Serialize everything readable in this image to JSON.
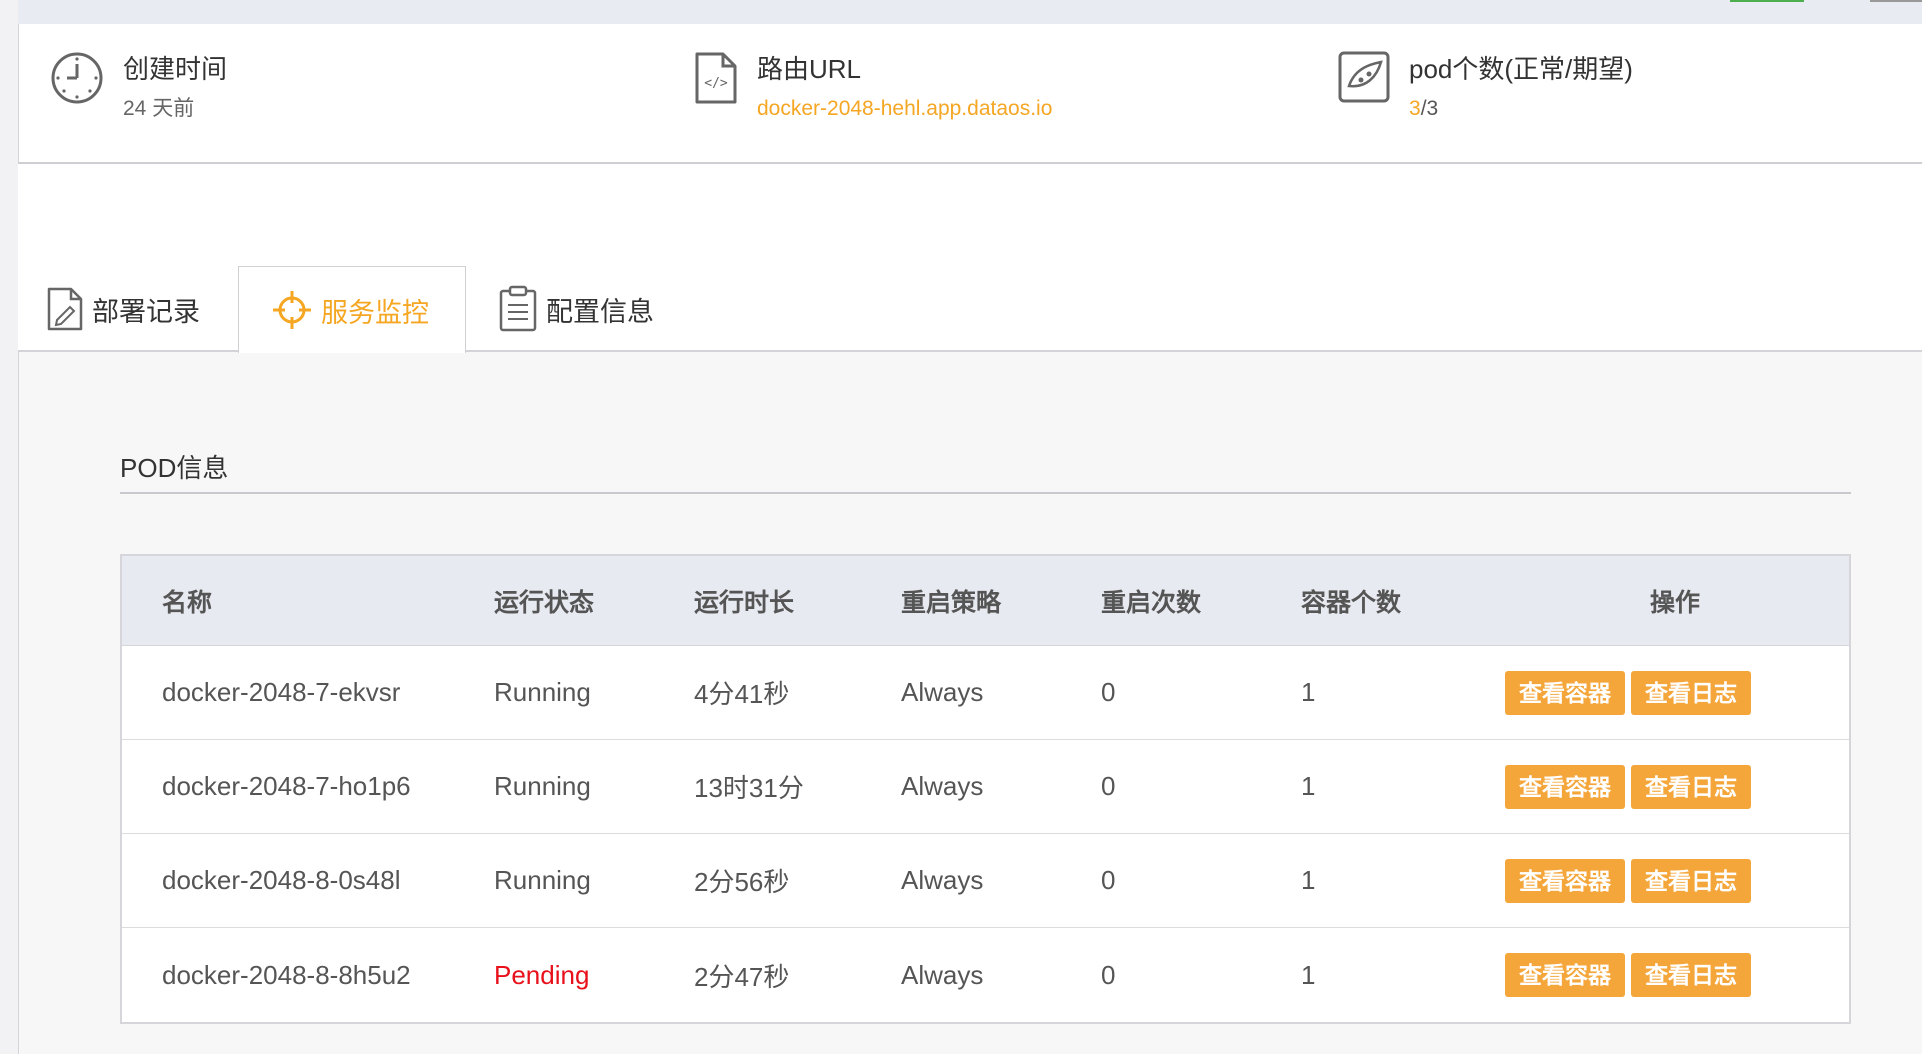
{
  "summary": {
    "created": {
      "icon": "clock-icon",
      "label": "创建时间",
      "value": "24 天前"
    },
    "route": {
      "icon": "code-file-icon",
      "label": "路由URL",
      "value": "docker-2048-hehl.app.dataos.io"
    },
    "pods": {
      "icon": "pod-icon",
      "label": "pod个数(正常/期望)",
      "ok": "3",
      "total": "/3"
    }
  },
  "tabs": [
    {
      "icon": "document-edit-icon",
      "label": "部署记录",
      "active": false
    },
    {
      "icon": "target-icon",
      "label": "服务监控",
      "active": true
    },
    {
      "icon": "clipboard-icon",
      "label": "配置信息",
      "active": false
    }
  ],
  "section": {
    "title": "POD信息"
  },
  "table": {
    "headers": [
      "名称",
      "运行状态",
      "运行时长",
      "重启策略",
      "重启次数",
      "容器个数",
      "操作"
    ],
    "rows": [
      {
        "name": "docker-2048-7-ekvsr",
        "status": "Running",
        "uptime": "4分41秒",
        "policy": "Always",
        "restarts": "0",
        "containers": "1",
        "btn1": "查看容器",
        "btn2": "查看日志"
      },
      {
        "name": "docker-2048-7-ho1p6",
        "status": "Running",
        "uptime": "13时31分",
        "policy": "Always",
        "restarts": "0",
        "containers": "1",
        "btn1": "查看容器",
        "btn2": "查看日志"
      },
      {
        "name": "docker-2048-8-0s48l",
        "status": "Running",
        "uptime": "2分56秒",
        "policy": "Always",
        "restarts": "0",
        "containers": "1",
        "btn1": "查看容器",
        "btn2": "查看日志"
      },
      {
        "name": "docker-2048-8-8h5u2",
        "status": "Pending",
        "uptime": "2分47秒",
        "policy": "Always",
        "restarts": "0",
        "containers": "1",
        "btn1": "查看容器",
        "btn2": "查看日志"
      }
    ]
  },
  "colors": {
    "accent": "#f5a623",
    "button": "#f5a63a",
    "pending": "#e8101b",
    "header_bg": "#e8eaf1"
  }
}
